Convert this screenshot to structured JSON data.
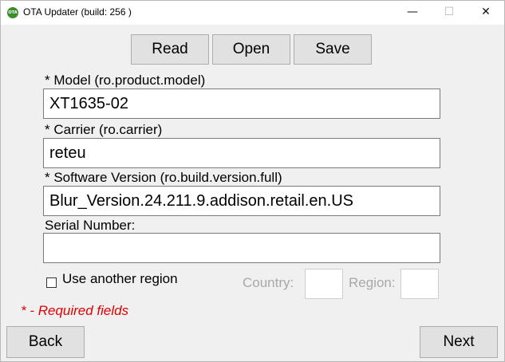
{
  "window": {
    "title": "OTA Updater (build: 256 )",
    "app_icon_text": "OTA",
    "minimize_glyph": "—",
    "maximize_glyph": "☐",
    "close_glyph": "✕"
  },
  "toolbar": {
    "read_label": "Read",
    "open_label": "Open",
    "save_label": "Save"
  },
  "form": {
    "model_label": "* Model (ro.product.model)",
    "model_value": "XT1635-02",
    "carrier_label": "* Carrier (ro.carrier)",
    "carrier_value": "reteu",
    "software_label": "* Software Version (ro.build.version.full)",
    "software_value": "Blur_Version.24.211.9.addison.retail.en.US",
    "serial_label": "Serial Number:",
    "serial_value": ""
  },
  "region": {
    "checkbox_label": "Use another region",
    "checked": false,
    "country_label": "Country:",
    "country_value": "",
    "region_label": "Region:",
    "region_value": ""
  },
  "footer": {
    "required_note": "* - Required fields",
    "back_label": "Back",
    "next_label": "Next"
  }
}
